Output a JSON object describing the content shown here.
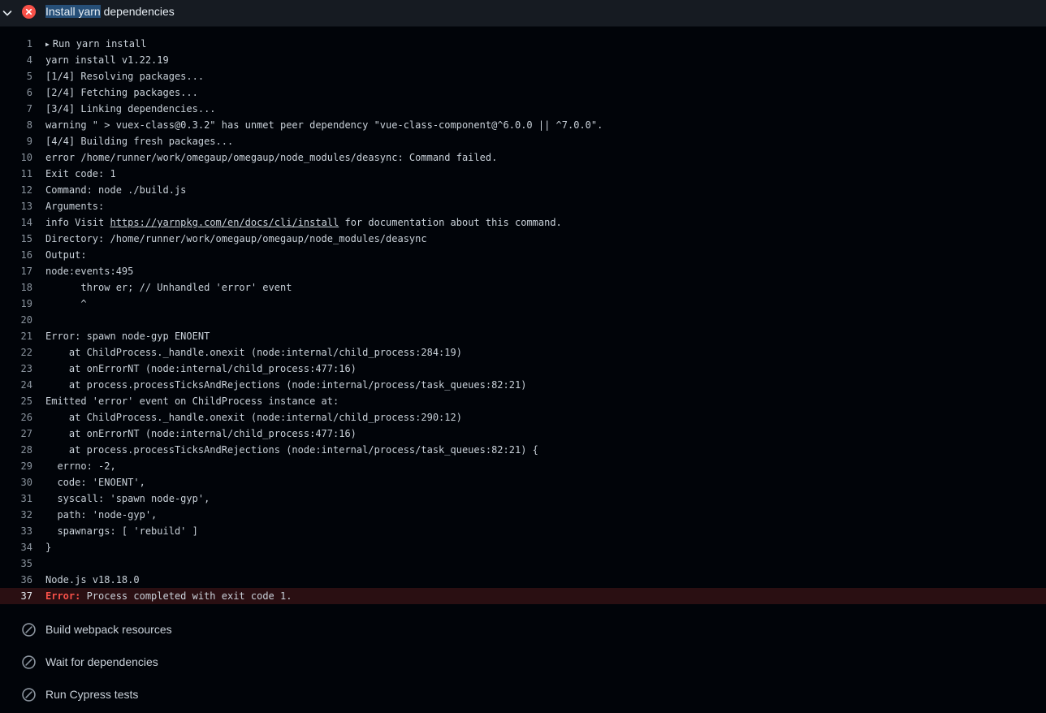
{
  "header": {
    "title_selected": "Install yarn",
    "title_rest": " dependencies"
  },
  "log": {
    "lines": [
      {
        "n": "1",
        "t": "Run yarn install",
        "collapsible": true
      },
      {
        "n": "4",
        "t": "yarn install v1.22.19"
      },
      {
        "n": "5",
        "t": "[1/4] Resolving packages..."
      },
      {
        "n": "6",
        "t": "[2/4] Fetching packages..."
      },
      {
        "n": "7",
        "t": "[3/4] Linking dependencies..."
      },
      {
        "n": "8",
        "t": "warning \" > vuex-class@0.3.2\" has unmet peer dependency \"vue-class-component@^6.0.0 || ^7.0.0\"."
      },
      {
        "n": "9",
        "t": "[4/4] Building fresh packages..."
      },
      {
        "n": "10",
        "t": "error /home/runner/work/omegaup/omegaup/node_modules/deasync: Command failed."
      },
      {
        "n": "11",
        "t": "Exit code: 1"
      },
      {
        "n": "12",
        "t": "Command: node ./build.js"
      },
      {
        "n": "13",
        "t": "Arguments:"
      },
      {
        "n": "14",
        "t_pre": "info Visit ",
        "link": "https://yarnpkg.com/en/docs/cli/install",
        "t_post": " for documentation about this command."
      },
      {
        "n": "15",
        "t": "Directory: /home/runner/work/omegaup/omegaup/node_modules/deasync"
      },
      {
        "n": "16",
        "t": "Output:"
      },
      {
        "n": "17",
        "t": "node:events:495"
      },
      {
        "n": "18",
        "t": "      throw er; // Unhandled 'error' event"
      },
      {
        "n": "19",
        "t": "      ^"
      },
      {
        "n": "20",
        "t": ""
      },
      {
        "n": "21",
        "t": "Error: spawn node-gyp ENOENT"
      },
      {
        "n": "22",
        "t": "    at ChildProcess._handle.onexit (node:internal/child_process:284:19)"
      },
      {
        "n": "23",
        "t": "    at onErrorNT (node:internal/child_process:477:16)"
      },
      {
        "n": "24",
        "t": "    at process.processTicksAndRejections (node:internal/process/task_queues:82:21)"
      },
      {
        "n": "25",
        "t": "Emitted 'error' event on ChildProcess instance at:"
      },
      {
        "n": "26",
        "t": "    at ChildProcess._handle.onexit (node:internal/child_process:290:12)"
      },
      {
        "n": "27",
        "t": "    at onErrorNT (node:internal/child_process:477:16)"
      },
      {
        "n": "28",
        "t": "    at process.processTicksAndRejections (node:internal/process/task_queues:82:21) {"
      },
      {
        "n": "29",
        "t": "  errno: -2,"
      },
      {
        "n": "30",
        "t": "  code: 'ENOENT',"
      },
      {
        "n": "31",
        "t": "  syscall: 'spawn node-gyp',"
      },
      {
        "n": "32",
        "t": "  path: 'node-gyp',"
      },
      {
        "n": "33",
        "t": "  spawnargs: [ 'rebuild' ]"
      },
      {
        "n": "34",
        "t": "}"
      },
      {
        "n": "35",
        "t": ""
      },
      {
        "n": "36",
        "t": "Node.js v18.18.0"
      },
      {
        "n": "37",
        "err_label": "Error:",
        "t": " Process completed with exit code 1.",
        "error": true
      }
    ]
  },
  "steps": [
    {
      "label": "Build webpack resources"
    },
    {
      "label": "Wait for dependencies"
    },
    {
      "label": "Run Cypress tests"
    }
  ],
  "colors": {
    "failure": "#f85149",
    "skipped": "#8b949e",
    "background": "#010409"
  }
}
